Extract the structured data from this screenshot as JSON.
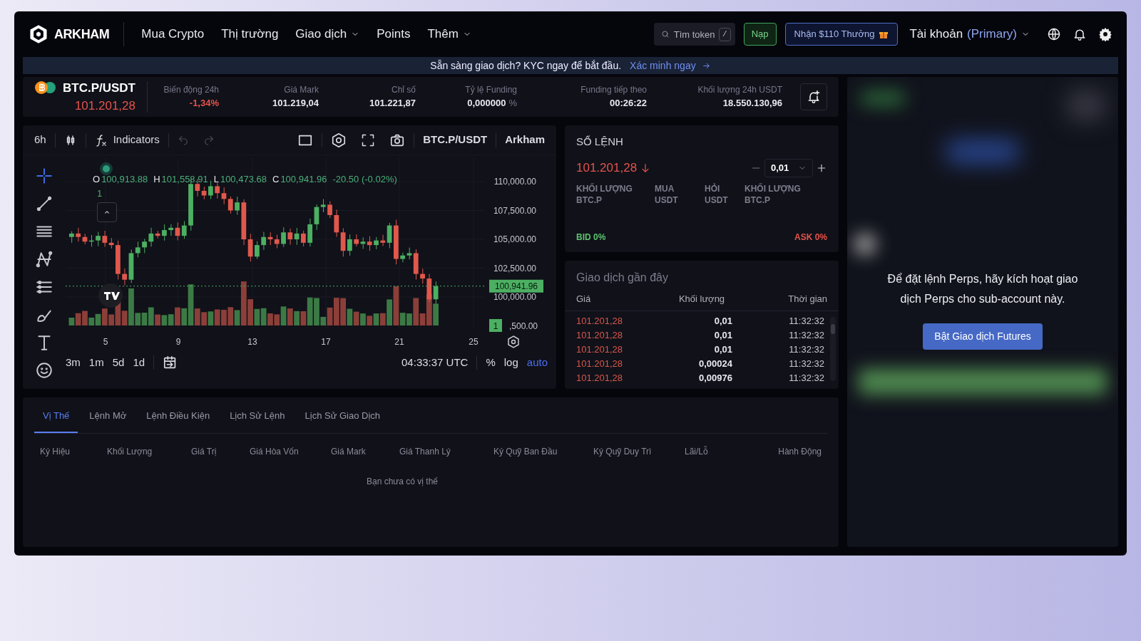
{
  "nav": {
    "brand": "ARKHAM",
    "items": [
      {
        "label": "Mua Crypto",
        "dropdown": false
      },
      {
        "label": "Thị trường",
        "dropdown": false
      },
      {
        "label": "Giao dịch",
        "dropdown": true
      },
      {
        "label": "Points",
        "dropdown": false
      },
      {
        "label": "Thêm",
        "dropdown": true
      }
    ],
    "search": {
      "placeholder": "Tìm token",
      "shortcut": "/"
    },
    "deposit": "Nạp",
    "reward": "Nhận $110 Thưởng",
    "account": "Tài khoản",
    "account_tag": "(Primary)"
  },
  "banner": {
    "text": "Sẵn sàng giao dịch? KYC ngay để bắt đầu.",
    "link": "Xác minh ngay"
  },
  "ticker": {
    "symbol": "BTC.P/USDT",
    "price": "101.201,28",
    "stats": [
      {
        "label": "Biến động 24h",
        "value": "-1,34%",
        "negative": true
      },
      {
        "label": "Giá Mark",
        "value": "101.219,04",
        "negative": false
      },
      {
        "label": "Chỉ số",
        "value": "101.221,87",
        "negative": false
      },
      {
        "label": "Tỷ lệ Funding",
        "value": "0,000000",
        "unit": "%",
        "negative": false
      },
      {
        "label": "Funding tiếp theo",
        "value": "00:26:22",
        "negative": false
      },
      {
        "label": "Khối lượng 24h USDT",
        "value": "18.550.130,96",
        "negative": false
      }
    ]
  },
  "chart": {
    "interval": "6h",
    "indicators": "Indicators",
    "symbol": "BTC.P/USDT",
    "source": "Arkham",
    "drawing_tools": [
      {
        "kind": "crosshair",
        "selected": true
      },
      {
        "kind": "line",
        "selected": false
      },
      {
        "kind": "lines",
        "selected": false
      },
      {
        "kind": "pattern",
        "selected": false
      },
      {
        "kind": "ruler",
        "selected": false
      },
      {
        "kind": "brush",
        "selected": false
      },
      {
        "kind": "text",
        "selected": false
      },
      {
        "kind": "emoji",
        "selected": false
      }
    ],
    "legend": [
      {
        "key": "O",
        "value": "100,913.88"
      },
      {
        "key": "H",
        "value": "101,558.91"
      },
      {
        "key": "L",
        "value": "100,473.68"
      },
      {
        "key": "C",
        "value": "100,941.96"
      },
      {
        "value": "-20.50 (-0.02%)"
      }
    ],
    "volume_legend": "1",
    "price_labels": [
      "110,000.00",
      "107,500.00",
      "105,000.00",
      "102,500.00",
      "100,000.00"
    ],
    "last_price": "100,941.96",
    "volume_badge": "1",
    "volume_tick": ",500.00",
    "time_labels": [
      "5",
      "9",
      "13",
      "17",
      "21",
      "25"
    ],
    "ranges": [
      "3m",
      "1m",
      "5d",
      "1d"
    ],
    "clock": "04:33:37 UTC",
    "scale_options": [
      {
        "label": "%",
        "selected": false
      },
      {
        "label": "log",
        "selected": false
      },
      {
        "label": "auto",
        "selected": true
      }
    ]
  },
  "order_book": {
    "title": "SỔ LỆNH",
    "price": "101.201,28",
    "step": "0,01",
    "columns": [
      {
        "top": "KHỐI LƯỢNG",
        "bottom": "BTC.P"
      },
      {
        "top": "MUA",
        "bottom": "USDT"
      },
      {
        "top": "HỎI",
        "bottom": "USDT"
      },
      {
        "top": "KHỐI LƯỢNG",
        "bottom": "BTC.P"
      }
    ],
    "bid": "BID 0%",
    "ask": "ASK 0%"
  },
  "recent_trades": {
    "title": "Giao dịch gần đây",
    "columns": [
      "Giá",
      "Khối lượng",
      "Thời gian"
    ],
    "rows": [
      {
        "price": "101.201,28",
        "size": "0,01",
        "time": "11:32:32",
        "sell": true
      },
      {
        "price": "101.201,28",
        "size": "0,01",
        "time": "11:32:32",
        "sell": true
      },
      {
        "price": "101.201,28",
        "size": "0,01",
        "time": "11:32:32",
        "sell": true
      },
      {
        "price": "101.201,28",
        "size": "0,00024",
        "time": "11:32:32",
        "sell": true
      },
      {
        "price": "101.201,28",
        "size": "0,00976",
        "time": "11:32:32",
        "sell": true
      }
    ]
  },
  "positions": {
    "tabs": [
      {
        "label": "Vị Thế",
        "selected": true
      },
      {
        "label": "Lệnh Mở",
        "selected": false
      },
      {
        "label": "Lệnh Điều Kiện",
        "selected": false
      },
      {
        "label": "Lịch Sử Lệnh",
        "selected": false
      },
      {
        "label": "Lịch Sử Giao Dịch",
        "selected": false
      }
    ],
    "columns": [
      "Ký Hiệu",
      "Khối Lượng",
      "Giá Trị",
      "Giá Hòa Vốn",
      "Giá Mark",
      "Giá Thanh Lý",
      "Ký Quỹ Ban Đầu",
      "Ký Quỹ Duy Trì",
      "Lãi/Lỗ",
      "Hành Động"
    ],
    "empty": "Bạn chưa có vị thế"
  },
  "perps_panel": {
    "message": "Để đặt lệnh Perps, hãy kích hoạt giao dịch Perps cho sub-account này.",
    "button": "Bật Giao dịch Futures"
  }
}
